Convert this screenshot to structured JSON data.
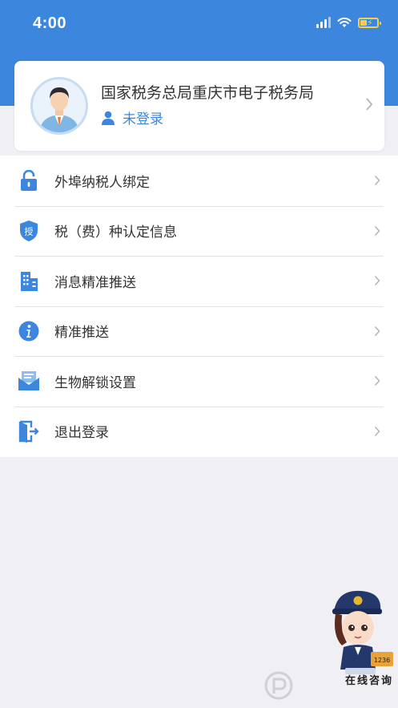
{
  "status_bar": {
    "time": "4:00"
  },
  "profile": {
    "org_name": "国家税务总局重庆市电子税务局",
    "login_status": "未登录"
  },
  "menu": [
    {
      "label": "外埠纳税人绑定",
      "icon": "lock-icon"
    },
    {
      "label": "税（费）种认定信息",
      "icon": "shield-icon"
    },
    {
      "label": "消息精准推送",
      "icon": "building-icon"
    },
    {
      "label": "精准推送",
      "icon": "info-icon"
    },
    {
      "label": "生物解锁设置",
      "icon": "envelope-icon"
    },
    {
      "label": "退出登录",
      "icon": "logout-icon"
    }
  ],
  "shield_badge_text": "授",
  "mascot": {
    "label": "在线咨询",
    "badge": "1236"
  },
  "colors": {
    "accent": "#3d86dd",
    "background": "#efeff4",
    "text": "#333333"
  }
}
